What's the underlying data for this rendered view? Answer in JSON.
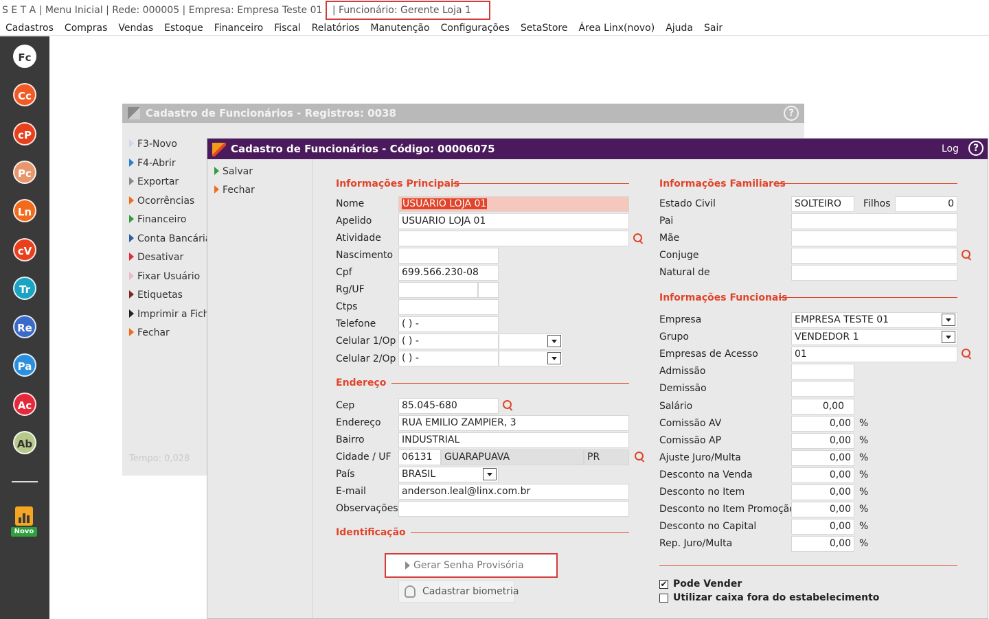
{
  "titlebar": {
    "text": "S E T A | Menu Inicial | Rede: 000005 | Empresa: Empresa Teste  01",
    "employee": "| Funcionário: Gerente Loja 1"
  },
  "menubar": [
    "Cadastros",
    "Compras",
    "Vendas",
    "Estoque",
    "Financeiro",
    "Fiscal",
    "Relatórios",
    "Manutenção",
    "Configurações",
    "SetaStore",
    "Área Linx(novo)",
    "Ajuda",
    "Sair"
  ],
  "sidebar": {
    "apps": [
      {
        "label": "Fc",
        "color": "#ffffff",
        "text": "#333333"
      },
      {
        "label": "Cc",
        "color": "#f15a24",
        "text": "#ffffff"
      },
      {
        "label": "cP",
        "color": "#e8401c",
        "text": "#ffffff"
      },
      {
        "label": "Pc",
        "color": "#e8966b",
        "text": "#ffffff"
      },
      {
        "label": "Ln",
        "color": "#f26b1d",
        "text": "#ffffff"
      },
      {
        "label": "cV",
        "color": "#e8401c",
        "text": "#ffffff"
      },
      {
        "label": "Tr",
        "color": "#1aa3c2",
        "text": "#ffffff"
      },
      {
        "label": "Re",
        "color": "#3a6bc8",
        "text": "#ffffff"
      },
      {
        "label": "Pa",
        "color": "#2b8fe0",
        "text": "#ffffff"
      },
      {
        "label": "Ac",
        "color": "#e5283a",
        "text": "#ffffff"
      },
      {
        "label": "Ab",
        "color": "#b6c98a",
        "text": "#333333"
      }
    ],
    "novo_label": "Novo"
  },
  "bg_window": {
    "title": "Cadastro de Funcionários - Registros: 0038",
    "help": "?",
    "menu": [
      {
        "label": "F3-Novo",
        "color": "#cfd8e6"
      },
      {
        "label": "F4-Abrir",
        "color": "#2b7fd0"
      },
      {
        "label": "Exportar",
        "color": "#8a8a8a"
      },
      {
        "label": "Ocorrências",
        "color": "#f26b1d"
      },
      {
        "label": "Financeiro",
        "color": "#2e9e3e"
      },
      {
        "label": "Conta Bancária",
        "color": "#2b5fa0"
      },
      {
        "label": "Desativar",
        "color": "#e5283a"
      },
      {
        "label": "Fixar Usuário",
        "color": "#f0b8c8"
      },
      {
        "label": "Etiquetas",
        "color": "#7a2a1a"
      },
      {
        "label": "Imprimir a Ficha",
        "color": "#222222"
      },
      {
        "label": "Fechar",
        "color": "#f26b1d"
      }
    ],
    "tempo": "Tempo:  0,028"
  },
  "fg_window": {
    "title": "Cadastro de Funcionários - Código: 00006075",
    "log": "Log",
    "help": "?",
    "menu": [
      {
        "label": "Salvar",
        "color": "#2e9e3e"
      },
      {
        "label": "Fechar",
        "color": "#f26b1d"
      }
    ]
  },
  "principal": {
    "section": "Informações Principais",
    "nome_label": "Nome",
    "nome": "USUARIO LOJA 01",
    "apelido_label": "Apelido",
    "apelido": "USUARIO LOJA 01",
    "atividade_label": "Atividade",
    "atividade": "",
    "nascimento_label": "Nascimento",
    "nascimento": "",
    "cpf_label": "Cpf",
    "cpf": "699.566.230-08",
    "rg_label": "Rg/UF",
    "rg": "",
    "rg_uf": "",
    "ctps_label": "Ctps",
    "ctps": "",
    "telefone_label": "Telefone",
    "telefone": "( )   -",
    "cel1_label": "Celular 1/Op",
    "cel1": "( )   -",
    "cel1_op": "",
    "cel2_label": "Celular 2/Op",
    "cel2": "( )   -",
    "cel2_op": ""
  },
  "endereco": {
    "section": "Endereço",
    "cep_label": "Cep",
    "cep": "85.045-680",
    "endereco_label": "Endereço",
    "endereco": "RUA EMILIO ZAMPIER, 3",
    "bairro_label": "Bairro",
    "bairro": "INDUSTRIAL",
    "cidade_label": "Cidade / UF",
    "cidade_cod": "06131",
    "cidade": "GUARAPUAVA",
    "uf": "PR",
    "pais_label": "País",
    "pais": "BRASIL",
    "email_label": "E-mail",
    "email": "anderson.leal@linx.com.br",
    "obs_label": "Observações",
    "obs": ""
  },
  "identificacao": {
    "section": "Identificação",
    "gerar_senha": "Gerar Senha Provisória",
    "biometria": "Cadastrar biometria"
  },
  "familiares": {
    "section": "Informações Familiares",
    "estado_civil_label": "Estado Civil",
    "estado_civil": "SOLTEIRO",
    "filhos_label": "Filhos",
    "filhos": "0",
    "pai_label": "Pai",
    "pai": "",
    "mae_label": "Mãe",
    "mae": "",
    "conjuge_label": "Conjuge",
    "conjuge": "",
    "natural_label": "Natural de",
    "natural": ""
  },
  "funcionais": {
    "section": "Informações Funcionais",
    "empresa_label": "Empresa",
    "empresa": "EMPRESA TESTE  01",
    "grupo_label": "Grupo",
    "grupo": "VENDEDOR 1",
    "acesso_label": "Empresas de Acesso",
    "acesso": "01",
    "admissao_label": "Admissão",
    "admissao": "",
    "demissao_label": "Demissão",
    "demissao": "",
    "salario_label": "Salário",
    "salario": "0,00",
    "pct_symbol": "%",
    "rates": [
      {
        "label": "Comissão AV",
        "value": "0,00"
      },
      {
        "label": "Comissão AP",
        "value": "0,00"
      },
      {
        "label": "Ajuste Juro/Multa",
        "value": "0,00"
      },
      {
        "label": "Desconto na Venda",
        "value": "0,00"
      },
      {
        "label": "Desconto no Item",
        "value": "0,00"
      },
      {
        "label": "Desconto no Item Promoção",
        "value": "0,00"
      },
      {
        "label": "Desconto no Capital",
        "value": "0,00"
      },
      {
        "label": "Rep. Juro/Multa",
        "value": "0,00"
      }
    ]
  },
  "checks": {
    "pode_vender": "Pode Vender",
    "pode_vender_checked": "✔",
    "caixa_fora": "Utilizar caixa fora do estabelecimento"
  }
}
